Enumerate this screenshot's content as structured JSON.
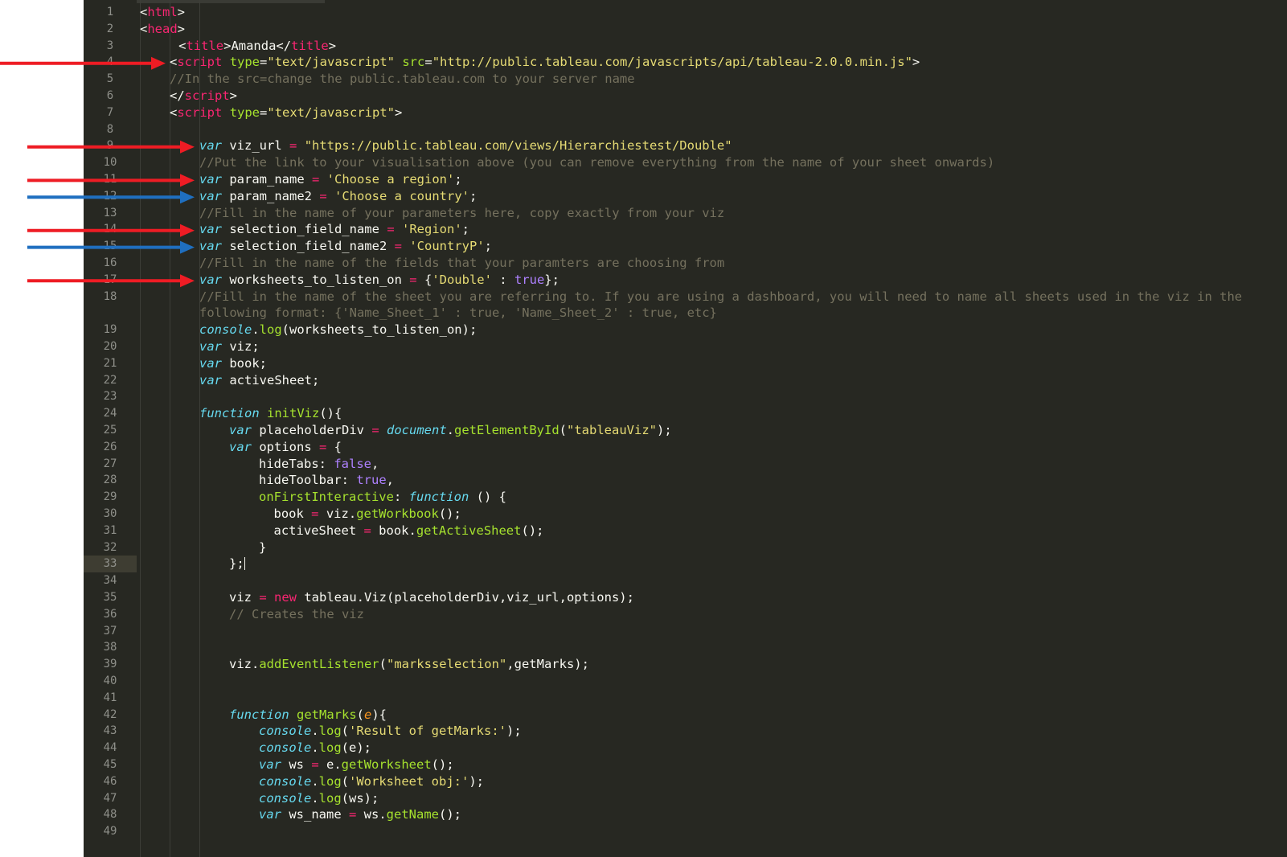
{
  "editor": {
    "current_line": "33",
    "lines": [
      {
        "n": "1",
        "indent": 0,
        "tokens": [
          [
            "plain",
            "<"
          ],
          [
            "tag",
            "html"
          ],
          [
            "plain",
            ">"
          ]
        ]
      },
      {
        "n": "2",
        "indent": 0,
        "tokens": [
          [
            "plain",
            "<"
          ],
          [
            "tag",
            "head"
          ],
          [
            "plain",
            ">"
          ]
        ]
      },
      {
        "n": "3",
        "indent": 1.3,
        "tokens": [
          [
            "plain",
            "<"
          ],
          [
            "tag",
            "title"
          ],
          [
            "plain",
            ">Amanda</"
          ],
          [
            "tag",
            "title"
          ],
          [
            "plain",
            ">"
          ]
        ]
      },
      {
        "n": "4",
        "indent": 1,
        "tokens": [
          [
            "plain",
            "<"
          ],
          [
            "tag",
            "script"
          ],
          [
            "plain",
            " "
          ],
          [
            "attr",
            "type"
          ],
          [
            "plain",
            "="
          ],
          [
            "str",
            "\"text/javascript\""
          ],
          [
            "plain",
            " "
          ],
          [
            "attr",
            "src"
          ],
          [
            "plain",
            "="
          ],
          [
            "str",
            "\"http://public.tableau.com/javascripts/api/tableau-2.0.0.min.js\""
          ],
          [
            "plain",
            ">"
          ]
        ]
      },
      {
        "n": "5",
        "indent": 1,
        "tokens": [
          [
            "cmt",
            "//In the src=change the public.tableau.com to your server name"
          ]
        ]
      },
      {
        "n": "6",
        "indent": 1,
        "tokens": [
          [
            "plain",
            "</"
          ],
          [
            "tag",
            "script"
          ],
          [
            "plain",
            ">"
          ]
        ]
      },
      {
        "n": "7",
        "indent": 1,
        "tokens": [
          [
            "plain",
            "<"
          ],
          [
            "tag",
            "script"
          ],
          [
            "plain",
            " "
          ],
          [
            "attr",
            "type"
          ],
          [
            "plain",
            "="
          ],
          [
            "str",
            "\"text/javascript\""
          ],
          [
            "plain",
            ">"
          ]
        ]
      },
      {
        "n": "8",
        "indent": 0,
        "tokens": []
      },
      {
        "n": "9",
        "indent": 2,
        "tokens": [
          [
            "kw",
            "var"
          ],
          [
            "plain",
            " viz_url "
          ],
          [
            "op",
            "="
          ],
          [
            "plain",
            " "
          ],
          [
            "str",
            "\"https://public.tableau.com/views/Hierarchiestest/Double\""
          ]
        ]
      },
      {
        "n": "10",
        "indent": 2,
        "tokens": [
          [
            "cmt",
            "//Put the link to your visualisation above (you can remove everything from the name of your sheet onwards)"
          ]
        ]
      },
      {
        "n": "11",
        "indent": 2,
        "tokens": [
          [
            "kw",
            "var"
          ],
          [
            "plain",
            " param_name "
          ],
          [
            "op",
            "="
          ],
          [
            "plain",
            " "
          ],
          [
            "str",
            "'Choose a region'"
          ],
          [
            "plain",
            ";"
          ]
        ]
      },
      {
        "n": "12",
        "indent": 2,
        "tokens": [
          [
            "kw",
            "var"
          ],
          [
            "plain",
            " param_name2 "
          ],
          [
            "op",
            "="
          ],
          [
            "plain",
            " "
          ],
          [
            "str",
            "'Choose a country'"
          ],
          [
            "plain",
            ";"
          ]
        ]
      },
      {
        "n": "13",
        "indent": 2,
        "tokens": [
          [
            "cmt",
            "//Fill in the name of your parameters here, copy exactly from your viz"
          ]
        ]
      },
      {
        "n": "14",
        "indent": 2,
        "tokens": [
          [
            "kw",
            "var"
          ],
          [
            "plain",
            " selection_field_name "
          ],
          [
            "op",
            "="
          ],
          [
            "plain",
            " "
          ],
          [
            "str",
            "'Region'"
          ],
          [
            "plain",
            ";"
          ]
        ]
      },
      {
        "n": "15",
        "indent": 2,
        "tokens": [
          [
            "kw",
            "var"
          ],
          [
            "plain",
            " selection_field_name2 "
          ],
          [
            "op",
            "="
          ],
          [
            "plain",
            " "
          ],
          [
            "str",
            "'CountryP'"
          ],
          [
            "plain",
            ";"
          ]
        ]
      },
      {
        "n": "16",
        "indent": 2,
        "tokens": [
          [
            "cmt",
            "//Fill in the name of the fields that your paramters are choosing from"
          ]
        ]
      },
      {
        "n": "17",
        "indent": 2,
        "tokens": [
          [
            "kw",
            "var"
          ],
          [
            "plain",
            " worksheets_to_listen_on "
          ],
          [
            "op",
            "="
          ],
          [
            "plain",
            " {"
          ],
          [
            "str",
            "'Double'"
          ],
          [
            "plain",
            " : "
          ],
          [
            "bool",
            "true"
          ],
          [
            "plain",
            "};"
          ]
        ]
      },
      {
        "n": "18",
        "indent": 2,
        "tokens": [
          [
            "cmt",
            "//Fill in the name of the sheet you are referring to. If you are using a dashboard, you will need to name all sheets used in the viz in the"
          ]
        ]
      },
      {
        "n": "",
        "indent": 2,
        "tokens": [
          [
            "cmt",
            "following format: {'Name_Sheet_1' : true, 'Name_Sheet_2' : true, etc}"
          ]
        ]
      },
      {
        "n": "19",
        "indent": 2,
        "tokens": [
          [
            "lib",
            "console"
          ],
          [
            "plain",
            "."
          ],
          [
            "fn",
            "log"
          ],
          [
            "plain",
            "(worksheets_to_listen_on);"
          ]
        ]
      },
      {
        "n": "20",
        "indent": 2,
        "tokens": [
          [
            "kw",
            "var"
          ],
          [
            "plain",
            " viz;"
          ]
        ]
      },
      {
        "n": "21",
        "indent": 2,
        "tokens": [
          [
            "kw",
            "var"
          ],
          [
            "plain",
            " book;"
          ]
        ]
      },
      {
        "n": "22",
        "indent": 2,
        "tokens": [
          [
            "kw",
            "var"
          ],
          [
            "plain",
            " activeSheet;"
          ]
        ]
      },
      {
        "n": "23",
        "indent": 0,
        "tokens": []
      },
      {
        "n": "24",
        "indent": 2,
        "tokens": [
          [
            "kw",
            "function"
          ],
          [
            "plain",
            " "
          ],
          [
            "fn",
            "initViz"
          ],
          [
            "plain",
            "(){"
          ]
        ]
      },
      {
        "n": "25",
        "indent": 3,
        "tokens": [
          [
            "kw",
            "var"
          ],
          [
            "plain",
            " placeholderDiv "
          ],
          [
            "op",
            "="
          ],
          [
            "plain",
            " "
          ],
          [
            "lib",
            "document"
          ],
          [
            "plain",
            "."
          ],
          [
            "fn",
            "getElementById"
          ],
          [
            "plain",
            "("
          ],
          [
            "str",
            "\"tableauViz\""
          ],
          [
            "plain",
            ");"
          ]
        ]
      },
      {
        "n": "26",
        "indent": 3,
        "tokens": [
          [
            "kw",
            "var"
          ],
          [
            "plain",
            " options "
          ],
          [
            "op",
            "="
          ],
          [
            "plain",
            " {"
          ]
        ]
      },
      {
        "n": "27",
        "indent": 4,
        "tokens": [
          [
            "plain",
            "hideTabs: "
          ],
          [
            "bool",
            "false"
          ],
          [
            "plain",
            ","
          ]
        ]
      },
      {
        "n": "28",
        "indent": 4,
        "tokens": [
          [
            "plain",
            "hideToolbar: "
          ],
          [
            "bool",
            "true"
          ],
          [
            "plain",
            ","
          ]
        ]
      },
      {
        "n": "29",
        "indent": 4,
        "tokens": [
          [
            "prop",
            "onFirstInteractive"
          ],
          [
            "plain",
            ": "
          ],
          [
            "kw",
            "function"
          ],
          [
            "plain",
            " () {"
          ]
        ]
      },
      {
        "n": "30",
        "indent": 4.5,
        "tokens": [
          [
            "plain",
            "book "
          ],
          [
            "op",
            "="
          ],
          [
            "plain",
            " viz."
          ],
          [
            "fn",
            "getWorkbook"
          ],
          [
            "plain",
            "();"
          ]
        ]
      },
      {
        "n": "31",
        "indent": 4.5,
        "tokens": [
          [
            "plain",
            "activeSheet "
          ],
          [
            "op",
            "="
          ],
          [
            "plain",
            " book."
          ],
          [
            "fn",
            "getActiveSheet"
          ],
          [
            "plain",
            "();"
          ]
        ]
      },
      {
        "n": "32",
        "indent": 4,
        "tokens": [
          [
            "plain",
            "}"
          ]
        ]
      },
      {
        "n": "33",
        "indent": 3,
        "tokens": [
          [
            "plain",
            "};"
          ],
          [
            "caret",
            ""
          ]
        ]
      },
      {
        "n": "34",
        "indent": 0,
        "tokens": []
      },
      {
        "n": "35",
        "indent": 3,
        "tokens": [
          [
            "plain",
            "viz "
          ],
          [
            "op",
            "="
          ],
          [
            "plain",
            " "
          ],
          [
            "new",
            "new"
          ],
          [
            "plain",
            " tableau.Viz(placeholderDiv,viz_url,options);"
          ]
        ]
      },
      {
        "n": "36",
        "indent": 3,
        "tokens": [
          [
            "cmt",
            "// Creates the viz"
          ]
        ]
      },
      {
        "n": "37",
        "indent": 0,
        "tokens": []
      },
      {
        "n": "38",
        "indent": 0,
        "tokens": []
      },
      {
        "n": "39",
        "indent": 3,
        "tokens": [
          [
            "plain",
            "viz."
          ],
          [
            "fn",
            "addEventListener"
          ],
          [
            "plain",
            "("
          ],
          [
            "str",
            "\"marksselection\""
          ],
          [
            "plain",
            ",getMarks);"
          ]
        ]
      },
      {
        "n": "40",
        "indent": 0,
        "tokens": []
      },
      {
        "n": "41",
        "indent": 0,
        "tokens": []
      },
      {
        "n": "42",
        "indent": 3,
        "tokens": [
          [
            "kw",
            "function"
          ],
          [
            "plain",
            " "
          ],
          [
            "fn",
            "getMarks"
          ],
          [
            "plain",
            "("
          ],
          [
            "param",
            "e"
          ],
          [
            "plain",
            "){"
          ]
        ]
      },
      {
        "n": "43",
        "indent": 4,
        "tokens": [
          [
            "lib",
            "console"
          ],
          [
            "plain",
            "."
          ],
          [
            "fn",
            "log"
          ],
          [
            "plain",
            "("
          ],
          [
            "str",
            "'Result of getMarks:'"
          ],
          [
            "plain",
            ");"
          ]
        ]
      },
      {
        "n": "44",
        "indent": 4,
        "tokens": [
          [
            "lib",
            "console"
          ],
          [
            "plain",
            "."
          ],
          [
            "fn",
            "log"
          ],
          [
            "plain",
            "(e);"
          ]
        ]
      },
      {
        "n": "45",
        "indent": 4,
        "tokens": [
          [
            "kw",
            "var"
          ],
          [
            "plain",
            " ws "
          ],
          [
            "op",
            "="
          ],
          [
            "plain",
            " e."
          ],
          [
            "fn",
            "getWorksheet"
          ],
          [
            "plain",
            "();"
          ]
        ]
      },
      {
        "n": "46",
        "indent": 4,
        "tokens": [
          [
            "lib",
            "console"
          ],
          [
            "plain",
            "."
          ],
          [
            "fn",
            "log"
          ],
          [
            "plain",
            "("
          ],
          [
            "str",
            "'Worksheet obj:'"
          ],
          [
            "plain",
            ");"
          ]
        ]
      },
      {
        "n": "47",
        "indent": 4,
        "tokens": [
          [
            "lib",
            "console"
          ],
          [
            "plain",
            "."
          ],
          [
            "fn",
            "log"
          ],
          [
            "plain",
            "(ws);"
          ]
        ]
      },
      {
        "n": "48",
        "indent": 4,
        "tokens": [
          [
            "kw",
            "var"
          ],
          [
            "plain",
            " ws_name "
          ],
          [
            "op",
            "="
          ],
          [
            "plain",
            " ws."
          ],
          [
            "fn",
            "getName"
          ],
          [
            "plain",
            "();"
          ]
        ]
      },
      {
        "n": "49",
        "indent": 0,
        "tokens": []
      }
    ]
  },
  "annotations": {
    "colors": {
      "red": "#ee1c24",
      "blue": "#1f6fc0"
    },
    "arrows": [
      {
        "line": "4",
        "color": "red"
      },
      {
        "line": "9",
        "color": "red"
      },
      {
        "line": "11",
        "color": "red"
      },
      {
        "line": "12",
        "color": "blue"
      },
      {
        "line": "14",
        "color": "red"
      },
      {
        "line": "15",
        "color": "blue"
      },
      {
        "line": "17",
        "color": "red"
      }
    ]
  }
}
